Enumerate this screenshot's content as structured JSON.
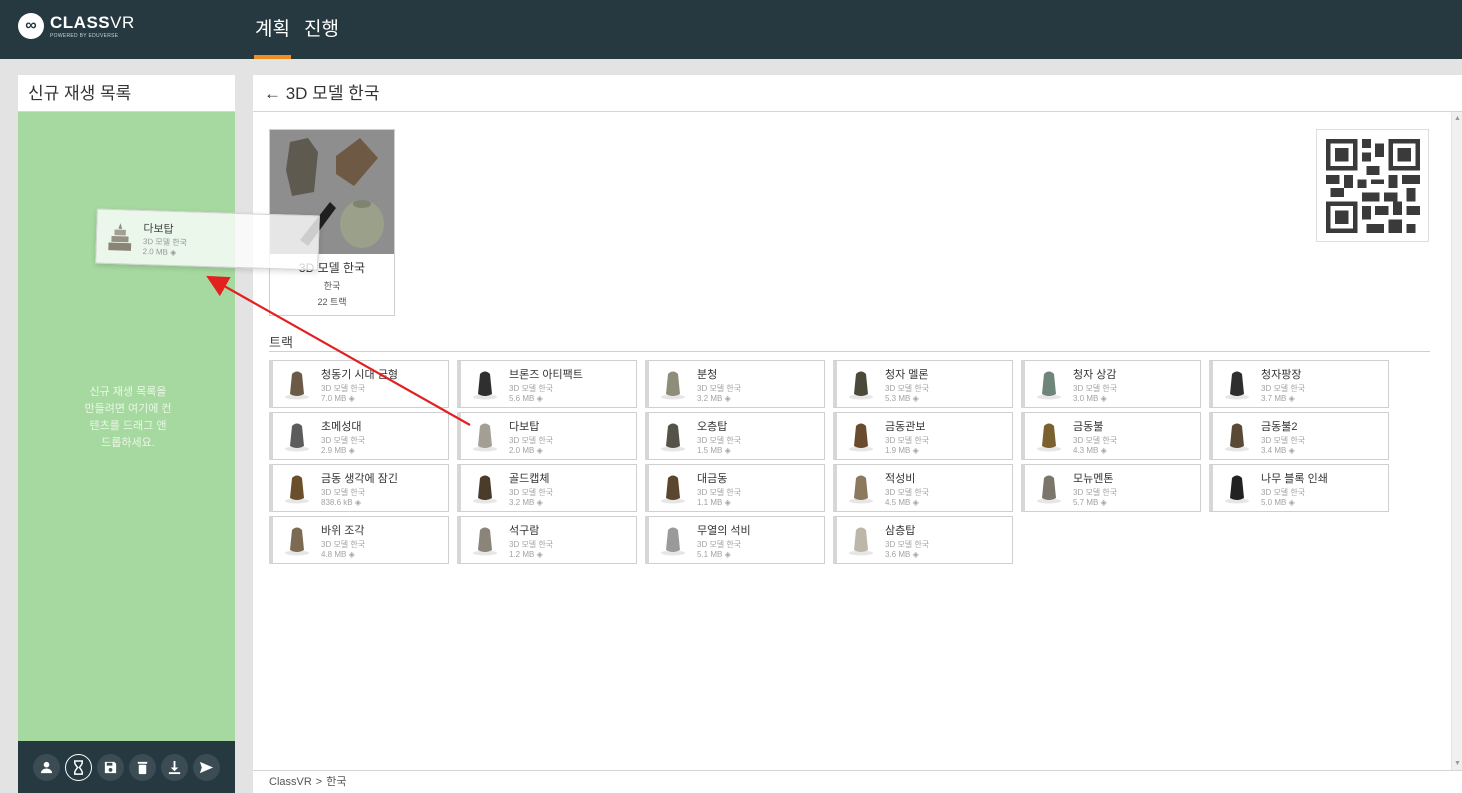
{
  "brand": {
    "name_bold": "CLASS",
    "name_light": "VR",
    "tagline": "POWERED BY EDUVERSE"
  },
  "nav": {
    "items": [
      {
        "label": "계획",
        "active": true
      },
      {
        "label": "진행",
        "active": false
      }
    ]
  },
  "playlist": {
    "title": "신규 재생 목록",
    "hint": "신규 재생 목록을 만들려면 여기에 컨텐츠를 드래그 앤 드롭하세요.",
    "toolbar": [
      "user-icon",
      "hourglass-icon",
      "save-icon",
      "trash-icon",
      "download-icon",
      "send-icon"
    ]
  },
  "dragging": {
    "title": "다보탑",
    "sub": "3D 모델 한국",
    "size": "2.0 MB"
  },
  "main": {
    "header": "← 3D 모델 한국",
    "album": {
      "title": "3D 모델 한국",
      "sub": "한국",
      "count": "22 트랙"
    },
    "tracks_label": "트랙",
    "tracks": [
      {
        "title": "청동기 시대 금형",
        "sub": "3D 모델 한국",
        "size": "7.0 MB",
        "thumb": "#6b5a45"
      },
      {
        "title": "브론즈 아티팩트",
        "sub": "3D 모델 한국",
        "size": "5.6 MB",
        "thumb": "#2f2f2f"
      },
      {
        "title": "분청",
        "sub": "3D 모델 한국",
        "size": "3.2 MB",
        "thumb": "#8d8d7a"
      },
      {
        "title": "청자 멜론",
        "sub": "3D 모델 한국",
        "size": "5.3 MB",
        "thumb": "#4b4a3a"
      },
      {
        "title": "청자 상감",
        "sub": "3D 모델 한국",
        "size": "3.0 MB",
        "thumb": "#6f8579"
      },
      {
        "title": "청자팡장",
        "sub": "3D 모델 한국",
        "size": "3.7 MB",
        "thumb": "#2e2e2e"
      },
      {
        "title": "초메성대",
        "sub": "3D 모델 한국",
        "size": "2.9 MB",
        "thumb": "#5c5c5c"
      },
      {
        "title": "다보탑",
        "sub": "3D 모델 한국",
        "size": "2.0 MB",
        "thumb": "#a39f95"
      },
      {
        "title": "오층탑",
        "sub": "3D 모델 한국",
        "size": "1.5 MB",
        "thumb": "#55524a"
      },
      {
        "title": "금동관보",
        "sub": "3D 모델 한국",
        "size": "1.9 MB",
        "thumb": "#6a4b2d"
      },
      {
        "title": "금동불",
        "sub": "3D 모델 한국",
        "size": "4.3 MB",
        "thumb": "#7b6030"
      },
      {
        "title": "금동불2",
        "sub": "3D 모델 한국",
        "size": "3.4 MB",
        "thumb": "#5a4a35"
      },
      {
        "title": "금동 생각에 잠긴",
        "sub": "3D 모델 한국",
        "size": "838.6 kB",
        "thumb": "#6b4e2b"
      },
      {
        "title": "골드캡체",
        "sub": "3D 모델 한국",
        "size": "3.2 MB",
        "thumb": "#4a3b2b"
      },
      {
        "title": "대금동",
        "sub": "3D 모델 한국",
        "size": "1.1 MB",
        "thumb": "#5b4630"
      },
      {
        "title": "적성비",
        "sub": "3D 모델 한국",
        "size": "4.5 MB",
        "thumb": "#8c7a5e"
      },
      {
        "title": "모뉴멘톤",
        "sub": "3D 모델 한국",
        "size": "5.7 MB",
        "thumb": "#7a766c"
      },
      {
        "title": "나무 블록 인쇄",
        "sub": "3D 모델 한국",
        "size": "5.0 MB",
        "thumb": "#222222"
      },
      {
        "title": "바위 조각",
        "sub": "3D 모델 한국",
        "size": "4.8 MB",
        "thumb": "#7d6a52"
      },
      {
        "title": "석구람",
        "sub": "3D 모델 한국",
        "size": "1.2 MB",
        "thumb": "#8a8578"
      },
      {
        "title": "무열의 석비",
        "sub": "3D 모델 한국",
        "size": "5.1 MB",
        "thumb": "#9a9a9a"
      },
      {
        "title": "삼층탑",
        "sub": "3D 모델 한국",
        "size": "3.6 MB",
        "thumb": "#bdb7aa"
      }
    ],
    "breadcrumb": [
      "ClassVR",
      "한국"
    ],
    "breadcrumb_sep": ">"
  },
  "colors": {
    "topbar": "#263840",
    "accent": "#f08c20",
    "dropzone": "#a6d9a0",
    "arrow": "#e32020"
  }
}
